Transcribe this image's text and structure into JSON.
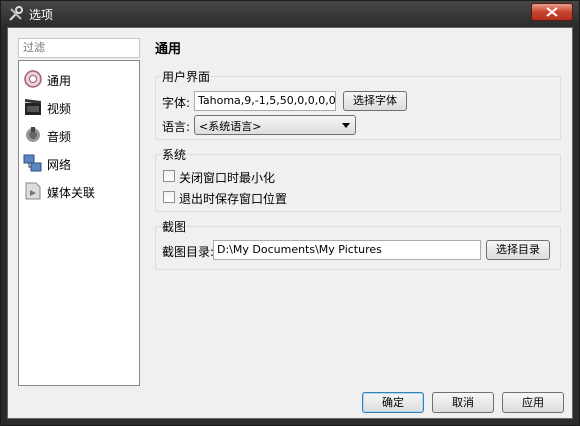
{
  "window": {
    "title": "选项",
    "close_icon": "close-icon"
  },
  "sidebar": {
    "filter_placeholder": "过滤",
    "items": [
      {
        "label": "通用",
        "icon": "general-icon"
      },
      {
        "label": "视频",
        "icon": "video-icon"
      },
      {
        "label": "音频",
        "icon": "audio-icon"
      },
      {
        "label": "网络",
        "icon": "network-icon"
      },
      {
        "label": "媒体关联",
        "icon": "media-association-icon"
      }
    ]
  },
  "page": {
    "title": "通用"
  },
  "ui_group": {
    "title": "用户界面",
    "font_label": "字体:",
    "font_value": "Tahoma,9,-1,5,50,0,0,0,0,0",
    "font_button": "选择字体",
    "language_label": "语言:",
    "language_value": "<系统语言>"
  },
  "system_group": {
    "title": "系统",
    "minimize_on_close": "关闭窗口时最小化",
    "save_position_on_exit": "退出时保存窗口位置"
  },
  "screenshot_group": {
    "title": "截图",
    "dir_label": "截图目录:",
    "dir_value": "D:\\My Documents\\My Pictures",
    "dir_button": "选择目录"
  },
  "buttons": {
    "ok": "确定",
    "cancel": "取消",
    "apply": "应用"
  }
}
